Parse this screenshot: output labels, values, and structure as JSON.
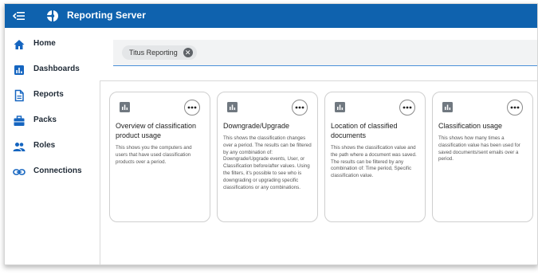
{
  "app": {
    "title": "Reporting Server"
  },
  "sidebar": {
    "items": [
      {
        "label": "Home",
        "icon": "home-icon"
      },
      {
        "label": "Dashboards",
        "icon": "dashboard-icon"
      },
      {
        "label": "Reports",
        "icon": "document-icon"
      },
      {
        "label": "Packs",
        "icon": "briefcase-icon"
      },
      {
        "label": "Roles",
        "icon": "people-icon"
      },
      {
        "label": "Connections",
        "icon": "link-icon"
      }
    ]
  },
  "filter": {
    "chip_label": "Titus Reporting"
  },
  "cards": [
    {
      "title": "Overview of classification product usage",
      "description": "This shows you the computers and users that have used classification products over a period."
    },
    {
      "title": "Downgrade/Upgrade",
      "description": "This shows the classification changes over a period. The results can be filtered by any combination of: Downgrade/Upgrade events, User, or Classification before/after values. Using the filters, it's possible to see who is downgrading or upgrading specific classifications or any combinations."
    },
    {
      "title": "Location of classified documents",
      "description": "This shows the classification value and the path where a document was saved. The results can be filtered by any combination of: Time period, Specific classification value."
    },
    {
      "title": "Classification usage",
      "description": "This shows how many times a classification value has been used for saved documents/sent emails over a period."
    }
  ],
  "colors": {
    "header": "#0f62ae",
    "icon_blue": "#1565c0",
    "card_icon": "#707880"
  }
}
